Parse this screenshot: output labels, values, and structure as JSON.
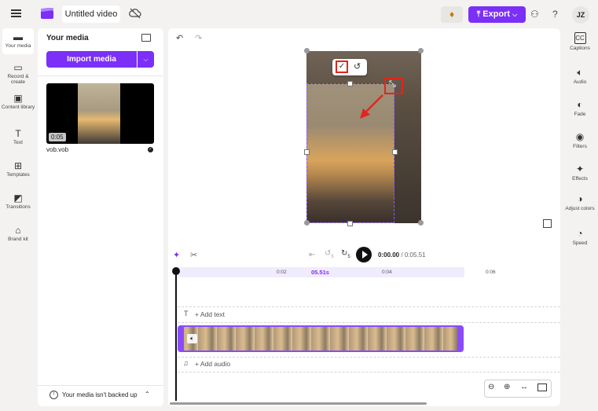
{
  "topbar": {
    "project_title": "Untitled video",
    "export_label": "Export",
    "avatar_initials": "JZ",
    "help_label": "?"
  },
  "left_rail": {
    "items": [
      {
        "label": "Your media",
        "icon": "folder-icon",
        "active": true
      },
      {
        "label": "Record & create",
        "icon": "camera-icon"
      },
      {
        "label": "Content library",
        "icon": "library-icon"
      },
      {
        "label": "Text",
        "icon": "text-icon"
      },
      {
        "label": "Templates",
        "icon": "templates-icon"
      },
      {
        "label": "Transitions",
        "icon": "transitions-icon"
      },
      {
        "label": "Brand kit",
        "icon": "brand-kit-icon"
      }
    ]
  },
  "media_panel": {
    "title": "Your media",
    "import_label": "Import media",
    "clip": {
      "duration": "0:05",
      "filename": "vob.vob"
    },
    "backup_notice": "Your media isn't backed up"
  },
  "right_rail": {
    "items": [
      {
        "label": "Captions",
        "icon": "captions-icon"
      },
      {
        "label": "Audio",
        "icon": "speaker-icon"
      },
      {
        "label": "Fade",
        "icon": "fade-icon"
      },
      {
        "label": "Filters",
        "icon": "filters-icon"
      },
      {
        "label": "Effects",
        "icon": "effects-icon"
      },
      {
        "label": "Adjust colors",
        "icon": "adjust-colors-icon"
      },
      {
        "label": "Speed",
        "icon": "speed-icon"
      }
    ]
  },
  "playback": {
    "current_time": "0:00.00",
    "separator": "/",
    "total_time": "0:05.51",
    "skip_back_label": "5",
    "skip_fwd_label": "5"
  },
  "ruler": {
    "marker_label": "05.51s",
    "ticks": [
      "0:02",
      "0:04",
      "0:06"
    ]
  },
  "tracks": {
    "add_text": "+ Add text",
    "add_audio": "+ Add audio"
  },
  "colors": {
    "accent": "#7b2ff7",
    "annotation_red": "#e0261c"
  }
}
